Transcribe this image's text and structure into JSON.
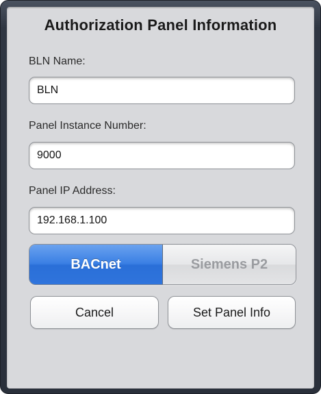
{
  "dialog": {
    "title": "Authorization Panel Information"
  },
  "fields": {
    "bln_name": {
      "label": "BLN Name:",
      "value": "BLN"
    },
    "panel_instance": {
      "label": "Panel Instance Number:",
      "value": "9000"
    },
    "panel_ip": {
      "label": "Panel IP Address:",
      "value": "192.168.1.100"
    }
  },
  "protocol": {
    "options": [
      "BACnet",
      "Siemens P2"
    ],
    "selected": "BACnet"
  },
  "buttons": {
    "cancel": "Cancel",
    "set_panel_info": "Set Panel Info"
  },
  "colors": {
    "selected_segment": "#3a7fe4",
    "frame": "#2f3642",
    "content_bg": "#d8d9dc"
  }
}
